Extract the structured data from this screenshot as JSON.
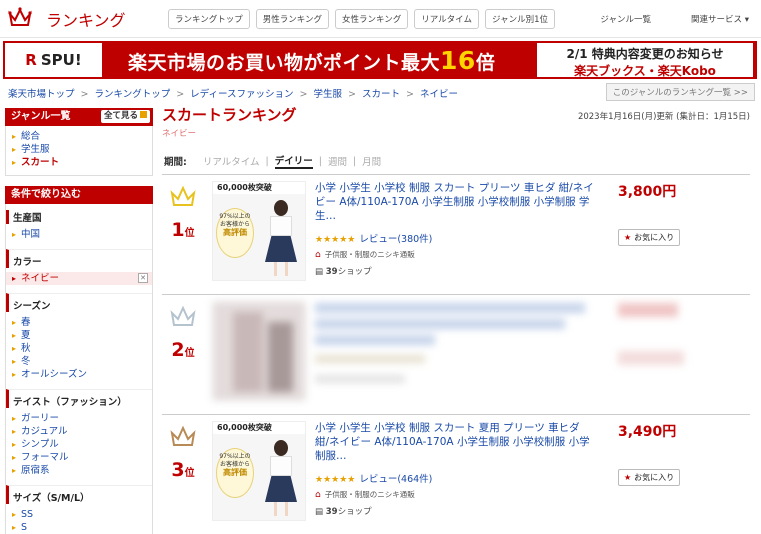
{
  "header": {
    "logo_text": "ランキング",
    "nav": [
      "ランキングトップ",
      "男性ランキング",
      "女性ランキング",
      "リアルタイム",
      "ジャンル別1位"
    ],
    "right_links": [
      "ジャンル一覧",
      "関連サービス"
    ]
  },
  "banner": {
    "spu": "SPU!",
    "main_a": "楽天市場のお買い物がポイント最大",
    "main_big": "16",
    "main_b": "倍",
    "notice1": "2/1 特典内容変更のお知らせ",
    "notice2": "楽天ブックス・楽天Kobo"
  },
  "breadcrumb": [
    "楽天市場トップ",
    "ランキングトップ",
    "レディースファッション",
    "学生服",
    "スカート",
    "ネイビー"
  ],
  "crumb_right": "このジャンルのランキング一覧 >>",
  "sidebar": {
    "genre_head": "ジャンル一覧",
    "see_all": "全て見る",
    "genre_links": [
      "総合",
      "学生服",
      "スカート"
    ],
    "filter_head": "条件で絞り込む",
    "sections": {
      "producer": {
        "title": "生産国",
        "items": [
          "中国"
        ]
      },
      "color": {
        "title": "カラー",
        "items": [
          "ネイビー"
        ]
      },
      "season": {
        "title": "シーズン",
        "items": [
          "春",
          "夏",
          "秋",
          "冬",
          "オールシーズン"
        ]
      },
      "taste": {
        "title": "テイスト（ファッション）",
        "items": [
          "ガーリー",
          "カジュアル",
          "シンプル",
          "フォーマル",
          "原宿系"
        ]
      },
      "size": {
        "title": "サイズ（S/M/L）",
        "items": [
          "SS",
          "S"
        ]
      }
    }
  },
  "main": {
    "title": "スカートランキング",
    "subtitle": "ネイビー",
    "updated": "2023年1月16日(月)更新 (集計日：1月15日)",
    "period_label": "期間:",
    "tabs": [
      "リアルタイム",
      "デイリー",
      "週間",
      "月間"
    ],
    "active_tab": "デイリー"
  },
  "items": [
    {
      "rank": "1",
      "rank_suffix": "位",
      "title": "小学 小学生 小学校 制服 スカート プリーツ 車ヒダ 紺/ネイビー A体/110A-170A 小学生制服 小学校制服 小学制服 学生…",
      "price": "3,800円",
      "stars": "★★★★★",
      "reviews": "レビュー(380件)",
      "shop": "子供服・制服のニシキ通販",
      "shops": "39",
      "shops_suffix": "ショップ",
      "fav": "お気に入り",
      "thumb_top": "60,000枚突破",
      "badge_top": "97%以上の",
      "badge_mid": "お客様から",
      "badge_bottom": "高評価",
      "crown_color": "#e8c21e"
    },
    {
      "rank": "2",
      "rank_suffix": "位",
      "crown_color": "#b5c3cf"
    },
    {
      "rank": "3",
      "rank_suffix": "位",
      "title": "小学 小学生 小学校 制服 スカート 夏用 プリーツ 車ヒダ 紺/ネイビー A体/110A-170A 小学生制服 小学校制服 小学制服…",
      "price": "3,490円",
      "stars": "★★★★★",
      "reviews": "レビュー(464件)",
      "shop": "子供服・制服のニシキ通販",
      "shops": "39",
      "shops_suffix": "ショップ",
      "fav": "お気に入り",
      "thumb_top": "60,000枚突破",
      "badge_top": "97%以上の",
      "badge_mid": "お客様から",
      "badge_bottom": "高評価",
      "crown_color": "#b88a55"
    }
  ]
}
